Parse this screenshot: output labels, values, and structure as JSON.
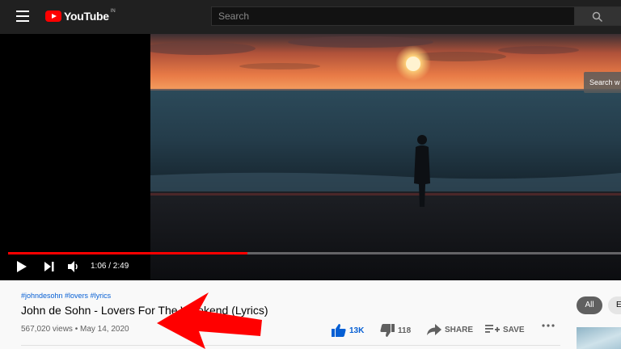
{
  "topbar": {
    "logo_text": "YouTube",
    "region": "IN",
    "search_placeholder": "Search",
    "icons": {
      "menu": "hamburger-menu-icon",
      "search": "search-icon"
    }
  },
  "player": {
    "current_time": "1:06",
    "duration": "2:49",
    "time_display": "1:06 / 2:49",
    "progress_fraction": 0.39,
    "overlay_label": "Search w",
    "icons": {
      "play": "play-icon",
      "next": "next-icon",
      "volume": "volume-icon"
    }
  },
  "video": {
    "hashtags": "#johndesohn #lovers #lyrics",
    "title": "John de Sohn - Lovers For The Weekend (Lyrics)",
    "views": "567,020 views",
    "date": "May 14, 2020",
    "meta": "567,020 views • May 14, 2020",
    "likes": "13K",
    "dislikes": "118",
    "share_label": "SHARE",
    "save_label": "SAVE",
    "accent_color": "#065fd4"
  },
  "sidebar": {
    "chips": [
      "All",
      "E"
    ]
  },
  "annotation": {
    "arrow_color": "#ff0000"
  }
}
